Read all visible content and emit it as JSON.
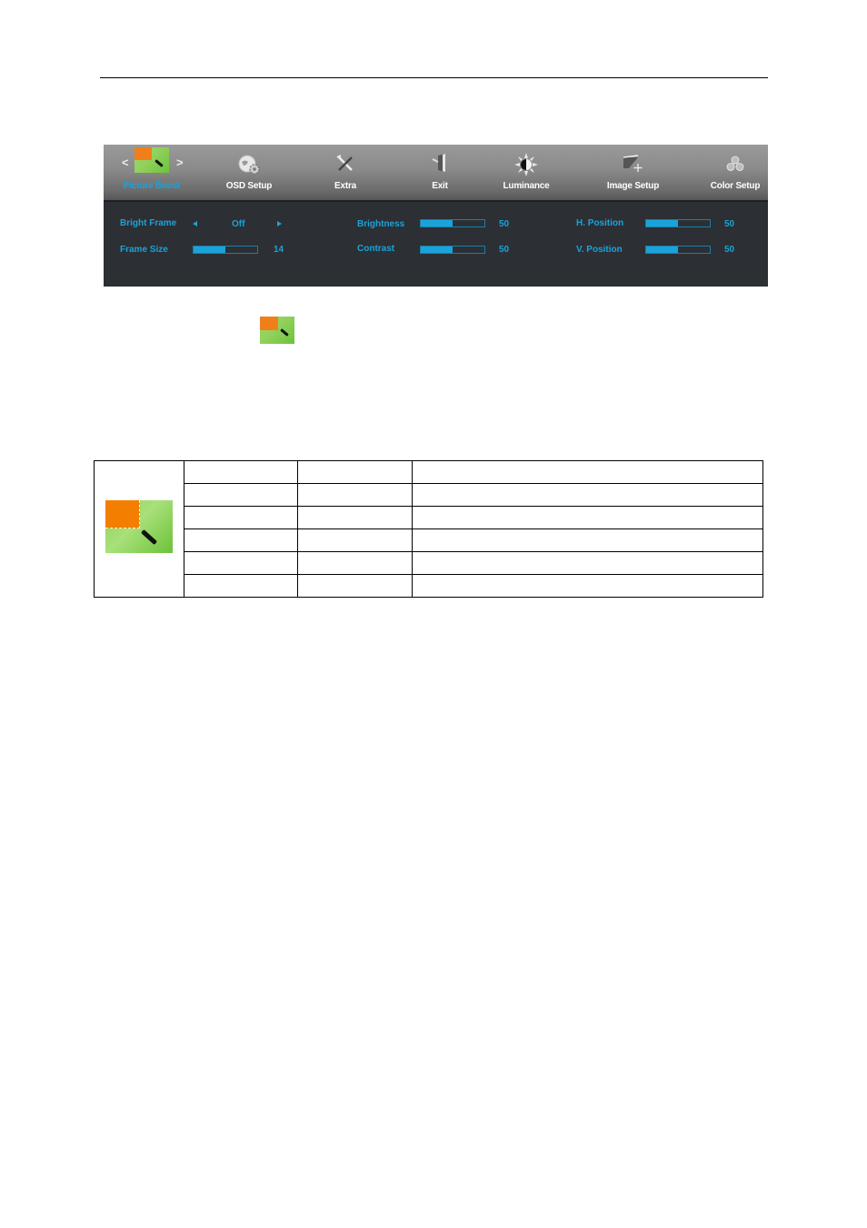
{
  "osd": {
    "tabs": [
      {
        "label": "Picture Boost",
        "icon": "picture-boost-icon",
        "active": true
      },
      {
        "label": "OSD Setup",
        "icon": "globe-gear-icon",
        "active": false
      },
      {
        "label": "Extra",
        "icon": "tools-icon",
        "active": false
      },
      {
        "label": "Exit",
        "icon": "exit-door-icon",
        "active": false
      },
      {
        "label": "Luminance",
        "icon": "sun-icon",
        "active": false
      },
      {
        "label": "Image Setup",
        "icon": "image-setup-icon",
        "active": false
      },
      {
        "label": "Color Setup",
        "icon": "color-dots-icon",
        "active": false
      }
    ],
    "nav": {
      "prev": "<",
      "next": ">"
    },
    "settings": {
      "bright_frame": {
        "label": "Bright Frame",
        "value": "Off"
      },
      "frame_size": {
        "label": "Frame Size",
        "value": "14",
        "fraction": 0.5
      },
      "brightness": {
        "label": "Brightness",
        "value": "50",
        "fraction": 0.5
      },
      "contrast": {
        "label": "Contrast",
        "value": "50",
        "fraction": 0.5
      },
      "h_position": {
        "label": "H. Position",
        "value": "50",
        "fraction": 0.5
      },
      "v_position": {
        "label": "V. Position",
        "value": "50",
        "fraction": 0.5
      }
    },
    "colors": {
      "accent": "#1aa3db",
      "panel_bg": "#2c2f33",
      "orange": "#f07f1a",
      "green": "#8fd05a"
    }
  },
  "table": {
    "icon": "picture-boost-icon",
    "rows": [
      [
        "",
        "",
        ""
      ],
      [
        "",
        "",
        ""
      ],
      [
        "",
        "",
        ""
      ],
      [
        "",
        "",
        ""
      ],
      [
        "",
        "",
        ""
      ],
      [
        "",
        "",
        ""
      ]
    ]
  }
}
